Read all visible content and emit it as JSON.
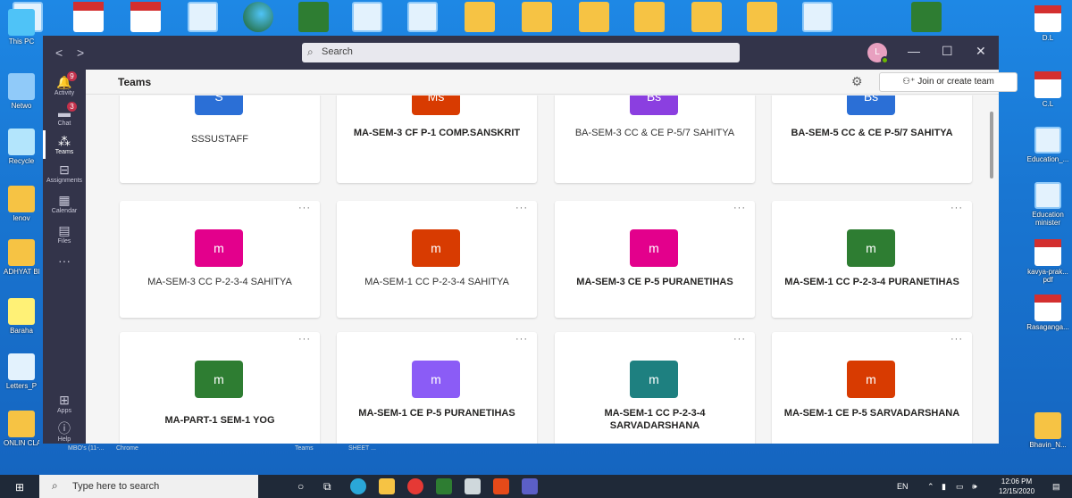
{
  "desktop": {
    "left_icons": [
      {
        "label": "This PC"
      },
      {
        "label": "Netwo"
      },
      {
        "label": "Recycle"
      },
      {
        "label": "lenov"
      },
      {
        "label": "ADHYAT BIO DA"
      },
      {
        "label": "Baraha"
      },
      {
        "label": "Letters_P"
      },
      {
        "label": "ONLIN CLASS LINK"
      }
    ],
    "right_icons": [
      {
        "label": "D.L"
      },
      {
        "label": "C.L"
      },
      {
        "label": "Education_..."
      },
      {
        "label": "Education minister"
      },
      {
        "label": "kavya-prak... pdf"
      },
      {
        "label": "Rasaganga..."
      },
      {
        "label": "Bhavin_N..."
      }
    ],
    "bottom_labels": [
      "MBO's (11-...",
      "Chrome",
      "Teams",
      "SHEET ..."
    ]
  },
  "window": {
    "nav_back": "<",
    "nav_forward": ">",
    "search_placeholder": "Search",
    "avatar_initials": "L",
    "minimize": "—",
    "maximize": "☐",
    "close": "✕"
  },
  "rail": [
    {
      "label": "Activity",
      "badge": "9"
    },
    {
      "label": "Chat",
      "badge": "3"
    },
    {
      "label": "Teams",
      "badge": ""
    },
    {
      "label": "Assignments",
      "badge": ""
    },
    {
      "label": "Calendar",
      "badge": ""
    },
    {
      "label": "Files",
      "badge": ""
    },
    {
      "label": "Apps",
      "badge": ""
    },
    {
      "label": "Help",
      "badge": ""
    }
  ],
  "header": {
    "title": "Teams",
    "join_button": "Join or create team"
  },
  "teams": [
    {
      "initials": "S",
      "name": "SSSUSTAFF",
      "bold": false,
      "color": "#2b6fd6"
    },
    {
      "initials": "Ms",
      "name": "MA-SEM-3 CF P-1 COMP.SANSKRIT",
      "bold": true,
      "color": "#d83b01"
    },
    {
      "initials": "Bs",
      "name": "BA-SEM-3 CC & CE P-5/7 SAHITYA",
      "bold": false,
      "color": "#8b3fe0"
    },
    {
      "initials": "Bs",
      "name": "BA-SEM-5 CC & CE P-5/7 SAHITYA",
      "bold": true,
      "color": "#2b6fd6"
    },
    {
      "initials": "m",
      "name": "MA-SEM-3 CC P-2-3-4 SAHITYA",
      "bold": false,
      "color": "#e3008c"
    },
    {
      "initials": "m",
      "name": "MA-SEM-1 CC P-2-3-4 SAHITYA",
      "bold": false,
      "color": "#d83b01"
    },
    {
      "initials": "m",
      "name": "MA-SEM-3 CE P-5 PURANETIHAS",
      "bold": true,
      "color": "#e3008c"
    },
    {
      "initials": "m",
      "name": "MA-SEM-1 CC P-2-3-4 PURANETIHAS",
      "bold": true,
      "color": "#2e7d32"
    },
    {
      "initials": "m",
      "name": "MA-PART-1 SEM-1 YOG",
      "bold": true,
      "color": "#2e7d32"
    },
    {
      "initials": "m",
      "name": "MA-SEM-1 CE P-5 PURANETIHAS",
      "bold": true,
      "color": "#8b5cf6"
    },
    {
      "initials": "m",
      "name": "MA-SEM-1 CC P-2-3-4 SARVADARSHANA",
      "bold": true,
      "color": "#1e8080"
    },
    {
      "initials": "m",
      "name": "MA-SEM-1 CE P-5 SARVADARSHANA",
      "bold": true,
      "color": "#d83b01"
    }
  ],
  "more_options": "···",
  "taskbar": {
    "search_placeholder": "Type here to search",
    "lang": "EN",
    "time": "12:06 PM",
    "date": "12/15/2020"
  }
}
